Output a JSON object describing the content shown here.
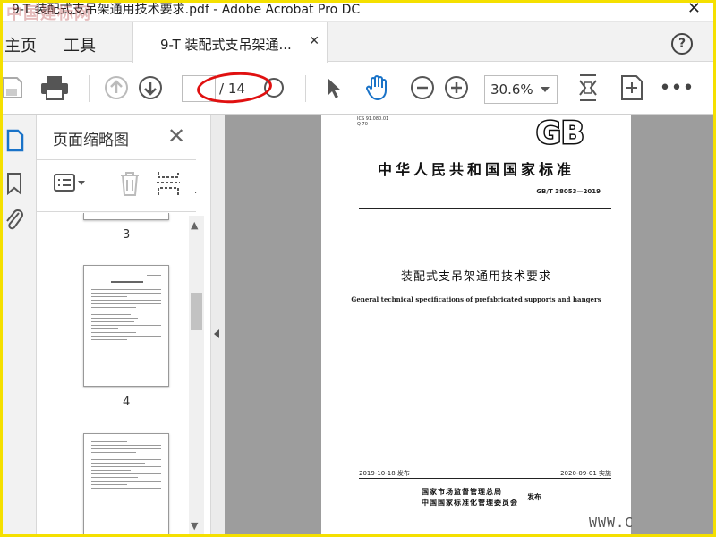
{
  "window": {
    "title": "9-T 装配式支吊架通用技术要求.pdf - Adobe Acrobat Pro DC",
    "watermark": "中国建标网"
  },
  "tabs": {
    "home": "主页",
    "tools": "工具",
    "document": "9-T 装配式支吊架通...",
    "help": "?"
  },
  "toolbar": {
    "page_current": "",
    "page_total": "/ 14",
    "zoom": "30.6%",
    "annotation_color": "#e01010"
  },
  "thumbnail_panel": {
    "title": "页面缩略图",
    "pages": [
      "3",
      "4"
    ]
  },
  "document": {
    "code_small": "ICS 91.080.01\nQ 70",
    "gb_logo": "GB",
    "standard_title": "中华人民共和国国家标准",
    "standard_no": "GB/T 38053—2019",
    "title_cn": "装配式支吊架通用技术要求",
    "title_en": "General technical specifications of prefabricated supports and hangers",
    "issue_date": "2019-10-18 发布",
    "impl_date": "2020-09-01 实施",
    "org1": "国家市场监督管理总局",
    "org2": "中国国家标准化管理委员会",
    "publish": "发布"
  },
  "site_watermark": "WWW.C"
}
